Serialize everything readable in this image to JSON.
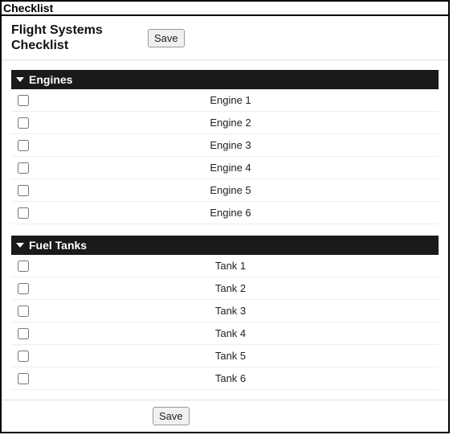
{
  "window": {
    "title": "Checklist"
  },
  "header": {
    "page_title": "Flight Systems Checklist",
    "save_label": "Save"
  },
  "sections": [
    {
      "title": "Engines",
      "items": [
        {
          "label": "Engine 1",
          "checked": false
        },
        {
          "label": "Engine 2",
          "checked": false
        },
        {
          "label": "Engine 3",
          "checked": false
        },
        {
          "label": "Engine 4",
          "checked": false
        },
        {
          "label": "Engine 5",
          "checked": false
        },
        {
          "label": "Engine 6",
          "checked": false
        }
      ]
    },
    {
      "title": "Fuel Tanks",
      "items": [
        {
          "label": "Tank 1",
          "checked": false
        },
        {
          "label": "Tank 2",
          "checked": false
        },
        {
          "label": "Tank 3",
          "checked": false
        },
        {
          "label": "Tank 4",
          "checked": false
        },
        {
          "label": "Tank 5",
          "checked": false
        },
        {
          "label": "Tank 6",
          "checked": false
        }
      ]
    }
  ],
  "footer": {
    "save_label": "Save"
  }
}
